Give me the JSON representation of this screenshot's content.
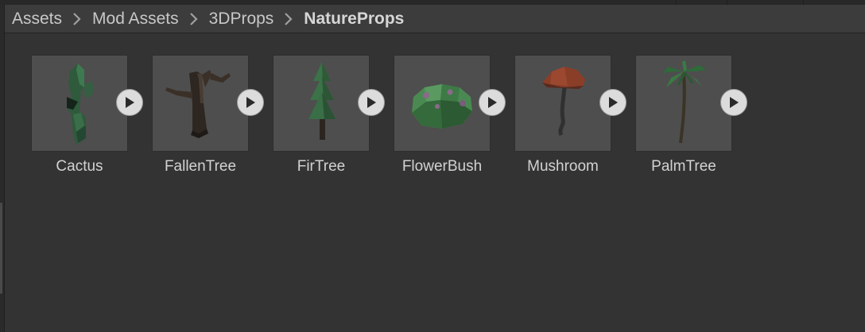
{
  "breadcrumb": {
    "items": [
      {
        "label": "Assets"
      },
      {
        "label": "Mod Assets"
      },
      {
        "label": "3DProps"
      },
      {
        "label": "NatureProps"
      }
    ]
  },
  "assets": [
    {
      "name": "Cactus",
      "icon": "cactus-icon"
    },
    {
      "name": "FallenTree",
      "icon": "fallen-tree-icon"
    },
    {
      "name": "FirTree",
      "icon": "fir-tree-icon"
    },
    {
      "name": "FlowerBush",
      "icon": "flower-bush-icon"
    },
    {
      "name": "Mushroom",
      "icon": "mushroom-icon"
    },
    {
      "name": "PalmTree",
      "icon": "palm-tree-icon"
    }
  ],
  "colors": {
    "panel_bg": "#333333",
    "thumb_bg": "#4e4e4e",
    "text": "#d2d2d2",
    "play_button": "#dcdcdc"
  }
}
